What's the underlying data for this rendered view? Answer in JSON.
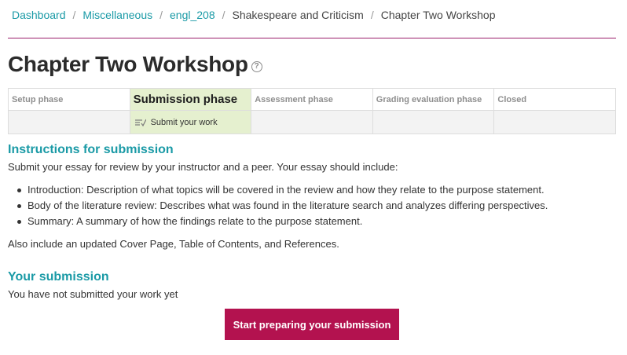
{
  "breadcrumb": {
    "items": [
      "Dashboard",
      "Miscellaneous",
      "engl_208",
      "Shakespeare and Criticism",
      "Chapter Two Workshop"
    ],
    "separator": "/"
  },
  "page": {
    "title": "Chapter Two Workshop",
    "help_icon": "help-circle-icon",
    "help_glyph": "?"
  },
  "phases": {
    "headers": [
      "Setup phase",
      "Submission phase",
      "Assessment phase",
      "Grading evaluation phase",
      "Closed"
    ],
    "active_index": 1,
    "active_task": "Submit your work",
    "task_icon": "task-list-icon"
  },
  "instructions": {
    "heading": "Instructions for submission",
    "intro": "Submit your essay for review by your instructor and a peer. Your essay should include:",
    "bullets": [
      "Introduction: Description of what topics will be covered in the review and how they relate to the purpose statement.",
      "Body of the literature review: Describes what was found in the literature search and analyzes differing perspectives.",
      "Summary: A summary of how the findings relate to the purpose statement."
    ],
    "footer": "Also include an updated Cover Page, Table of Contents, and References."
  },
  "submission": {
    "heading": "Your submission",
    "status": "You have not submitted your work yet",
    "button_label": "Start preparing your submission"
  },
  "colors": {
    "link": "#1a9aa6",
    "accent_rule": "#9b1f6c",
    "active_phase_bg": "#e5f0cf",
    "button_bg": "#b3124f"
  }
}
